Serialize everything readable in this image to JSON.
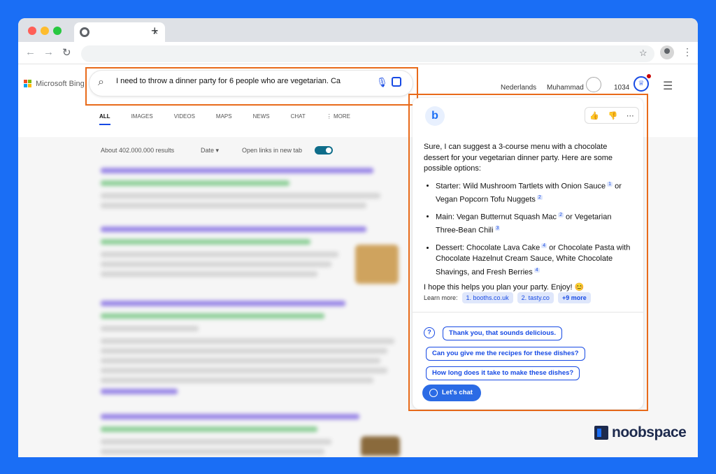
{
  "browser": {
    "tab_close": "×",
    "new_tab": "+",
    "back": "←",
    "forward": "→",
    "reload": "↻",
    "star": "☆",
    "menu": "⋮"
  },
  "bing": {
    "logo_text": "Microsoft Bing",
    "search_query": "I need to throw a dinner party for 6 people who are vegetarian. Ca",
    "tabs": [
      "ALL",
      "IMAGES",
      "VIDEOS",
      "MAPS",
      "NEWS",
      "CHAT",
      "⋮ MORE"
    ],
    "language": "Nederlands",
    "user_name": "Muhammad",
    "points": "1034",
    "results_count": "About 402.000.000 results",
    "date_filter": "Date ▾",
    "open_links_label": "Open links in new tab"
  },
  "chat": {
    "intro": "Sure, I can suggest a 3-course menu with a chocolate dessert for your vegetarian dinner party. Here are some possible options:",
    "options": [
      {
        "text_a": "Starter: Wild Mushroom Tartlets with Onion Sauce",
        "ref_a": "1",
        "text_b": " or Vegan Popcorn Tofu Nuggets",
        "ref_b": "2"
      },
      {
        "text_a": "Main: Vegan Butternut Squash Mac",
        "ref_a": "2",
        "text_b": " or Vegetarian Three-Bean Chili",
        "ref_b": "3"
      },
      {
        "text_a": "Dessert: Chocolate Lava Cake",
        "ref_a": "4",
        "text_b": " or Chocolate Pasta with Chocolate Hazelnut Cream Sauce, White Chocolate Shavings, and Fresh Berries",
        "ref_b": "4"
      }
    ],
    "closing": "I hope this helps you plan your party. Enjoy! 😊",
    "learn_more_label": "Learn more:",
    "sources": [
      "1. booths.co.uk",
      "2. tasty.co",
      "+9 more"
    ],
    "suggestions": [
      "Thank you, that sounds delicious.",
      "Can you give me the recipes for these dishes?",
      "How long does it take to make these dishes?"
    ],
    "lets_chat": "Let's chat",
    "feedback_icons": [
      "👍",
      "👎",
      "⋯"
    ]
  },
  "watermark": "noobspace",
  "colors": {
    "background": "#1a6ef5",
    "highlight_border": "#e86a1a",
    "bing_accent": "#174ae4"
  }
}
